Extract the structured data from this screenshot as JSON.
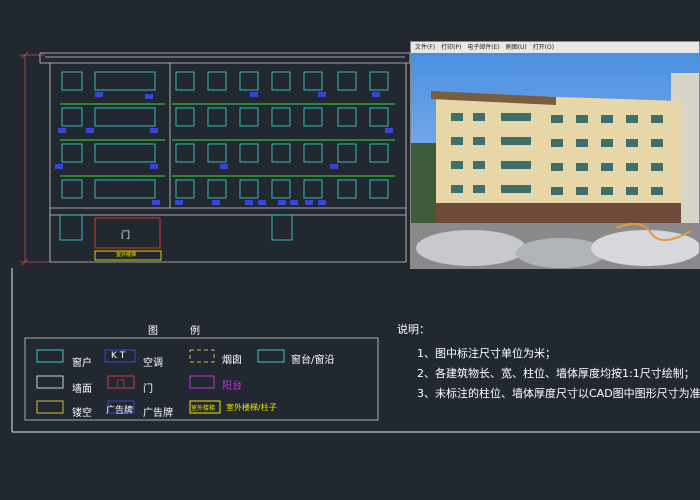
{
  "photo_menu": {
    "items": [
      "文件(F)",
      "打印(P)",
      "电子邮件(E)",
      "刷图(U)",
      "打开(O)"
    ]
  },
  "door_label": "门",
  "ac_tags": [
    "K T"
  ],
  "ground_sign": "室外楼梯",
  "legend": {
    "title_left": "图",
    "title_right": "例",
    "items": [
      {
        "label": "窗户",
        "color": "#3ec9c9"
      },
      {
        "label": "空调",
        "swatch_text": "K T",
        "color": "#3a43d8"
      },
      {
        "label": "烟囱",
        "color": "#d6b94a"
      },
      {
        "label": "窗台/窗沿",
        "color": "#3ec9c9"
      },
      {
        "label": "墙面",
        "color": "#cfcfcf"
      },
      {
        "label": "门",
        "swatch_text": "门",
        "color": "#e03a3a"
      },
      {
        "label": "阳台",
        "color": "#c62fd8"
      },
      {
        "label": "镂空",
        "color": "#d6b94a"
      },
      {
        "label": "广告牌",
        "swatch_text": "广告牌",
        "color": "#3a43d8"
      },
      {
        "label": "室外楼梯/柱子",
        "swatch_text": "室外楼梯",
        "color": "#f2e300"
      }
    ]
  },
  "notes": {
    "title": "说明：",
    "lines": [
      "1、图中标注尺寸单位为米；",
      "2、各建筑物长、宽、柱位、墙体厚度均按1:1尺寸绘制；",
      "3、未标注的柱位、墙体厚度尺寸以CAD图中图形尺寸为准。"
    ]
  },
  "colors": {
    "background": "#212830",
    "window": "#3ec9c9",
    "ledge": "#2fbf3a",
    "wall": "#cfcfcf",
    "door": "#e03a3a",
    "ac": "#3a43d8"
  }
}
